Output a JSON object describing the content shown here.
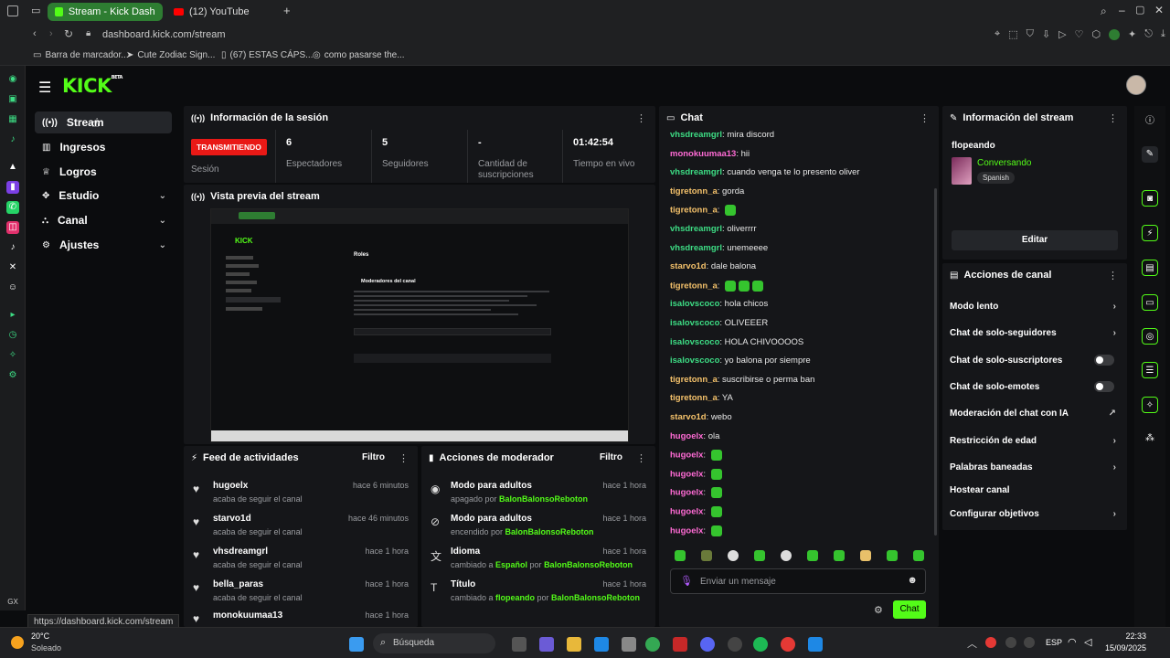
{
  "browser": {
    "tabs": [
      {
        "label": "Stream - Kick Dashbo"
      },
      {
        "label": "(12) YouTube"
      }
    ],
    "url": "dashboard.kick.com/stream",
    "bookmarks": [
      "Barra de marcador...",
      "Cute Zodiac Sign...",
      "(67) ESTAS CÁPS...",
      "como pasarse the..."
    ],
    "status_url": "https://dashboard.kick.com/stream"
  },
  "app": {
    "logo": "KICK",
    "logo_badge": "BETA"
  },
  "nav": {
    "items": [
      {
        "label": "Stream",
        "icon": "broadcast-icon"
      },
      {
        "label": "Ingresos",
        "icon": "chart-icon"
      },
      {
        "label": "Logros",
        "icon": "trophy-icon"
      },
      {
        "label": "Estudio",
        "icon": "studio-icon"
      },
      {
        "label": "Canal",
        "icon": "channel-icon"
      },
      {
        "label": "Ajustes",
        "icon": "gear-icon"
      }
    ]
  },
  "session": {
    "title": "Información de la sesión",
    "status_badge": "TRANSMITIENDO",
    "status_label": "Sesión",
    "stats": [
      {
        "value": "6",
        "label": "Espectadores"
      },
      {
        "value": "5",
        "label": "Seguidores"
      },
      {
        "value": "-",
        "label": "Cantidad de suscripciones"
      },
      {
        "value": "01:42:54",
        "label": "Tiempo en vivo"
      }
    ]
  },
  "preview": {
    "title": "Vista previa del stream",
    "inner_title": "Roles",
    "inner_heading": "Moderadores del canal"
  },
  "feed": {
    "title": "Feed de actividades",
    "filter": "Filtro",
    "items": [
      {
        "name": "hugoelx",
        "sub": "acaba de seguir el canal",
        "time": "hace 6 minutos"
      },
      {
        "name": "starvo1d",
        "sub": "acaba de seguir el canal",
        "time": "hace 46 minutos"
      },
      {
        "name": "vhsdreamgrl",
        "sub": "acaba de seguir el canal",
        "time": "hace 1 hora"
      },
      {
        "name": "bella_paras",
        "sub": "acaba de seguir el canal",
        "time": "hace 1 hora"
      },
      {
        "name": "monokuumaa13",
        "sub": "",
        "time": "hace 1 hora"
      }
    ]
  },
  "mod_actions": {
    "title": "Acciones de moderador",
    "filter": "Filtro",
    "items": [
      {
        "name": "Modo para adultos",
        "sub_pre": "apagado por ",
        "who": "BalonBalonsoReboton",
        "sub_mid": "",
        "time": "hace 1 hora"
      },
      {
        "name": "Modo para adultos",
        "sub_pre": "encendido por ",
        "who": "BalonBalonsoReboton",
        "sub_mid": "",
        "time": "hace 1 hora"
      },
      {
        "name": "Idioma",
        "sub_pre": "cambiado a ",
        "who": "BalonBalonsoReboton",
        "sub_mid": "Español",
        "time": "hace 1 hora"
      },
      {
        "name": "Título",
        "sub_pre": "cambiado a ",
        "who": "BalonBalonsoReboton",
        "sub_mid": "flopeando",
        "time": "hace 1 hora"
      }
    ],
    "por": " por "
  },
  "chat": {
    "title": "Chat",
    "messages": [
      {
        "user": "vhsdreamgrl",
        "color": "#3ddc84",
        "text": "mira discord"
      },
      {
        "user": "monokuumaa13",
        "color": "#ff6bd5",
        "text": "hii"
      },
      {
        "user": "vhsdreamgrl",
        "color": "#3ddc84",
        "text": "cuando venga te lo presento oliver"
      },
      {
        "user": "tigretonn_a",
        "color": "#f5c26b",
        "text": "gorda"
      },
      {
        "user": "tigretonn_a",
        "color": "#f5c26b",
        "text": ""
      },
      {
        "user": "vhsdreamgrl",
        "color": "#3ddc84",
        "text": "oliverrrr"
      },
      {
        "user": "vhsdreamgrl",
        "color": "#3ddc84",
        "text": "unemeeee"
      },
      {
        "user": "starvo1d",
        "color": "#f5c26b",
        "text": "dale balona"
      },
      {
        "user": "tigretonn_a",
        "color": "#f5c26b",
        "text": ""
      },
      {
        "user": "isalovscoco",
        "color": "#3ddc84",
        "text": "hola chicos"
      },
      {
        "user": "isalovscoco",
        "color": "#3ddc84",
        "text": "OLIVEEER"
      },
      {
        "user": "isalovscoco",
        "color": "#3ddc84",
        "text": "HOLA CHIVOOOOS"
      },
      {
        "user": "isalovscoco",
        "color": "#3ddc84",
        "text": "yo balona por siempre"
      },
      {
        "user": "tigretonn_a",
        "color": "#f5c26b",
        "text": "suscribirse o perma ban"
      },
      {
        "user": "tigretonn_a",
        "color": "#f5c26b",
        "text": "YA"
      },
      {
        "user": "starvo1d",
        "color": "#f5c26b",
        "text": "webo"
      },
      {
        "user": "hugoelx",
        "color": "#ff6bd5",
        "text": "ola"
      },
      {
        "user": "hugoelx",
        "color": "#ff6bd5",
        "text": ""
      },
      {
        "user": "hugoelx",
        "color": "#ff6bd5",
        "text": ""
      },
      {
        "user": "hugoelx",
        "color": "#ff6bd5",
        "text": ""
      },
      {
        "user": "hugoelx",
        "color": "#ff6bd5",
        "text": ""
      },
      {
        "user": "hugoelx",
        "color": "#ff6bd5",
        "text": ""
      }
    ],
    "emote_counts": [
      0,
      0,
      0,
      0,
      1,
      0,
      0,
      0,
      3,
      0,
      0,
      0,
      0,
      0,
      0,
      0,
      0,
      1,
      1,
      1,
      1,
      1
    ],
    "placeholder": "Enviar un mensaje",
    "send": "Chat"
  },
  "stream_info": {
    "title": "Información del stream",
    "stream_title": "flopeando",
    "category": "Conversando",
    "language": "Spanish",
    "edit": "Editar"
  },
  "channel_actions": {
    "title": "Acciones de canal",
    "items": [
      {
        "label": "Modo lento",
        "control": "chevron"
      },
      {
        "label": "Chat de solo-seguidores",
        "control": "chevron"
      },
      {
        "label": "Chat de solo-suscriptores",
        "control": "toggle"
      },
      {
        "label": "Chat de solo-emotes",
        "control": "toggle"
      },
      {
        "label": "Moderación del chat con IA",
        "control": "external"
      },
      {
        "label": "Restricción de edad",
        "control": "chevron"
      },
      {
        "label": "Palabras baneadas",
        "control": "chevron"
      },
      {
        "label": "Hostear canal",
        "control": "none"
      },
      {
        "label": "Configurar objetivos",
        "control": "chevron"
      }
    ]
  },
  "taskbar": {
    "weather_temp": "20°C",
    "weather_desc": "Soleado",
    "search": "Búsqueda",
    "lang": "ESP",
    "time": "22:33",
    "date": "15/09/2025"
  },
  "colors": {
    "accent": "#53fc18",
    "live": "#e91916"
  }
}
